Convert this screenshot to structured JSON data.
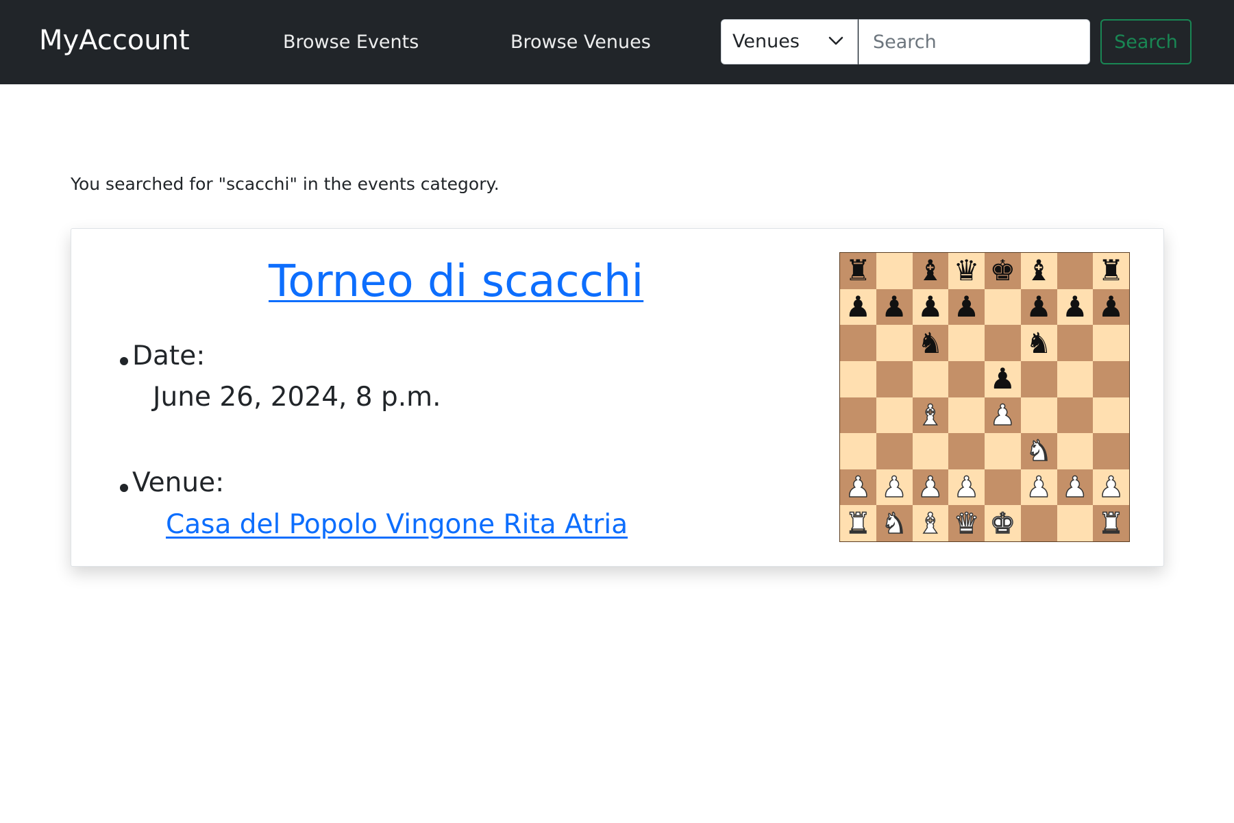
{
  "navbar": {
    "brand": "MyAccount",
    "links": [
      "Browse Events",
      "Browse Venues"
    ],
    "category_select": {
      "selected": "Venues"
    },
    "search_input": {
      "placeholder": "Search",
      "value": ""
    },
    "search_button": "Search"
  },
  "main": {
    "query_text": "You searched for \"scacchi\" in the events category.",
    "event": {
      "title": "Torneo di scacchi",
      "date_label": "Date:",
      "date_value": "June 26, 2024, 8 p.m.",
      "venue_label": "Venue:",
      "venue_name": "Casa del Popolo Vingone Rita Atria"
    },
    "chess_position": [
      [
        "bR",
        "",
        "bB",
        "bQ",
        "bK",
        "bB",
        "",
        "bR"
      ],
      [
        "bP",
        "bP",
        "bP",
        "bP",
        "",
        "bP",
        "bP",
        "bP"
      ],
      [
        "",
        "",
        "bN",
        "",
        "",
        "bN",
        "",
        ""
      ],
      [
        "",
        "",
        "",
        "",
        "bP",
        "",
        "",
        ""
      ],
      [
        "",
        "",
        "wB",
        "",
        "wP",
        "",
        "",
        ""
      ],
      [
        "",
        "",
        "",
        "",
        "",
        "wN",
        "",
        ""
      ],
      [
        "wP",
        "wP",
        "wP",
        "wP",
        "",
        "wP",
        "wP",
        "wP"
      ],
      [
        "wR",
        "wN",
        "wB",
        "wQ",
        "wK",
        "",
        "",
        "wR"
      ]
    ]
  }
}
